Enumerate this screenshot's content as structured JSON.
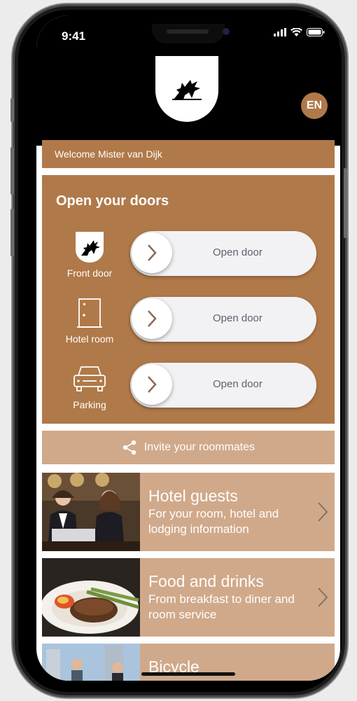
{
  "status_bar": {
    "time": "9:41"
  },
  "header": {
    "language": "EN"
  },
  "welcome": "Welcome Mister van Dijk",
  "doors": {
    "title": "Open your doors",
    "items": [
      {
        "label": "Front door",
        "action": "Open door",
        "icon": "griffin-logo-icon"
      },
      {
        "label": "Hotel room",
        "action": "Open door",
        "icon": "door-icon"
      },
      {
        "label": "Parking",
        "action": "Open door",
        "icon": "car-icon"
      }
    ]
  },
  "invite": {
    "label": "Invite your roommates"
  },
  "cards": [
    {
      "title": "Hotel guests",
      "subtitle": "For your room, hotel and lodging information"
    },
    {
      "title": "Food and drinks",
      "subtitle": "From breakfast to diner and room service"
    },
    {
      "title": "Bicycle",
      "subtitle": ""
    }
  ],
  "colors": {
    "brand": "#b07949",
    "card": "#d0a98a",
    "slider_text": "#5b6270"
  }
}
